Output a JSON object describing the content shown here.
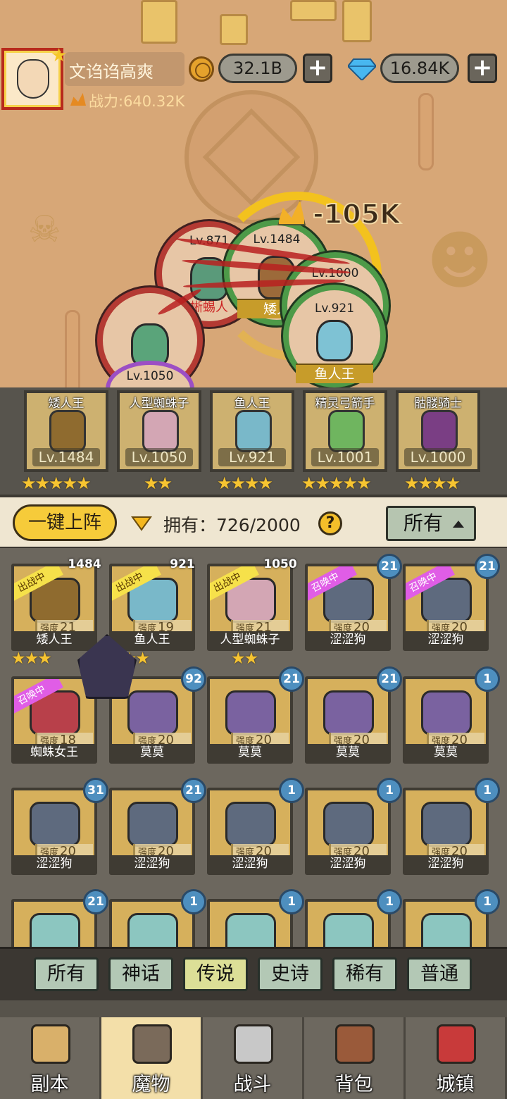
{
  "player": {
    "name": "文诌诌高爽",
    "power": "战力:640.32K",
    "gold": "32.1B",
    "gems": "16.84K"
  },
  "battle": {
    "damage": "-105K",
    "units": [
      {
        "level": "Lv.871",
        "label": "蜥蜴人"
      },
      {
        "level": "Lv.1484",
        "label": "矮人"
      },
      {
        "level": "Lv.1000",
        "label": ""
      },
      {
        "level": "Lv.921",
        "label": "鱼人王"
      },
      {
        "level": "Lv.1050",
        "label": ""
      },
      {
        "level": "",
        "label": ""
      }
    ]
  },
  "team": [
    {
      "name": "矮人王",
      "level": "Lv.1484",
      "stars": "★★★★★",
      "color": "#8f6b2f"
    },
    {
      "name": "人型蜘蛛子",
      "level": "Lv.1050",
      "stars": "★★",
      "color": "#d3a6b4"
    },
    {
      "name": "鱼人王",
      "level": "Lv.921",
      "stars": "★★★★",
      "color": "#79b8c9"
    },
    {
      "name": "精灵弓箭手",
      "level": "Lv.1001",
      "stars": "★★★★★",
      "color": "#6fb55f"
    },
    {
      "name": "骷髅骑士",
      "level": "Lv.1000",
      "stars": "★★★★",
      "color": "#7a3e84"
    }
  ],
  "toolbar": {
    "one_click": "一键上阵",
    "owned": "拥有：726/2000",
    "help": "?",
    "filter": "所有"
  },
  "monsters": [
    {
      "name": "矮人王",
      "strength_label": "强度",
      "strength": "21",
      "badge": "1484",
      "tag": "出战中",
      "tag_color": "yellow",
      "stars": "★★★"
    },
    {
      "name": "鱼人王",
      "strength_label": "强度",
      "strength": "19",
      "badge": "921",
      "tag": "出战中",
      "tag_color": "yellow",
      "stars": "★★★"
    },
    {
      "name": "人型蜘蛛子",
      "strength_label": "强度",
      "strength": "21",
      "badge": "1050",
      "tag": "出战中",
      "tag_color": "yellow",
      "stars": "★★"
    },
    {
      "name": "涩涩狗",
      "strength_label": "强度",
      "strength": "20",
      "badge": "21",
      "tag": "召唤中",
      "tag_color": "purple",
      "stars": ""
    },
    {
      "name": "涩涩狗",
      "strength_label": "强度",
      "strength": "20",
      "badge": "21",
      "tag": "召唤中",
      "tag_color": "purple",
      "stars": ""
    },
    {
      "name": "蜘蛛女王",
      "strength_label": "强度",
      "strength": "18",
      "badge": "",
      "tag": "召唤中",
      "tag_color": "purple",
      "stars": ""
    },
    {
      "name": "莫莫",
      "strength_label": "强度",
      "strength": "20",
      "badge": "92",
      "tag": "",
      "tag_color": "",
      "stars": ""
    },
    {
      "name": "莫莫",
      "strength_label": "强度",
      "strength": "20",
      "badge": "21",
      "tag": "",
      "tag_color": "",
      "stars": ""
    },
    {
      "name": "莫莫",
      "strength_label": "强度",
      "strength": "20",
      "badge": "21",
      "tag": "",
      "tag_color": "",
      "stars": ""
    },
    {
      "name": "莫莫",
      "strength_label": "强度",
      "strength": "20",
      "badge": "1",
      "tag": "",
      "tag_color": "",
      "stars": ""
    },
    {
      "name": "涩涩狗",
      "strength_label": "强度",
      "strength": "20",
      "badge": "31",
      "tag": "",
      "tag_color": "",
      "stars": ""
    },
    {
      "name": "涩涩狗",
      "strength_label": "强度",
      "strength": "20",
      "badge": "21",
      "tag": "",
      "tag_color": "",
      "stars": ""
    },
    {
      "name": "涩涩狗",
      "strength_label": "强度",
      "strength": "20",
      "badge": "1",
      "tag": "",
      "tag_color": "",
      "stars": ""
    },
    {
      "name": "涩涩狗",
      "strength_label": "强度",
      "strength": "20",
      "badge": "1",
      "tag": "",
      "tag_color": "",
      "stars": ""
    },
    {
      "name": "涩涩狗",
      "strength_label": "强度",
      "strength": "20",
      "badge": "1",
      "tag": "",
      "tag_color": "",
      "stars": ""
    },
    {
      "name": "",
      "strength_label": "",
      "strength": "",
      "badge": "21",
      "tag": "",
      "tag_color": "",
      "stars": ""
    },
    {
      "name": "",
      "strength_label": "",
      "strength": "",
      "badge": "1",
      "tag": "",
      "tag_color": "",
      "stars": ""
    },
    {
      "name": "",
      "strength_label": "",
      "strength": "",
      "badge": "1",
      "tag": "",
      "tag_color": "",
      "stars": ""
    },
    {
      "name": "",
      "strength_label": "",
      "strength": "",
      "badge": "1",
      "tag": "",
      "tag_color": "",
      "stars": ""
    },
    {
      "name": "",
      "strength_label": "",
      "strength": "",
      "badge": "1",
      "tag": "",
      "tag_color": "",
      "stars": ""
    }
  ],
  "rarity_tabs": [
    {
      "label": "所有",
      "active": false
    },
    {
      "label": "神话",
      "active": false
    },
    {
      "label": "传说",
      "active": true
    },
    {
      "label": "史诗",
      "active": false
    },
    {
      "label": "稀有",
      "active": false
    },
    {
      "label": "普通",
      "active": false
    }
  ],
  "nav": [
    {
      "label": "副本",
      "icon": "map-icon",
      "active": false
    },
    {
      "label": "魔物",
      "icon": "monster-helmet-icon",
      "active": true
    },
    {
      "label": "战斗",
      "icon": "crossed-swords-icon",
      "active": false
    },
    {
      "label": "背包",
      "icon": "backpack-icon",
      "active": false
    },
    {
      "label": "城镇",
      "icon": "town-shop-icon",
      "active": false
    }
  ],
  "colors": {
    "accent": "#f6cb3a",
    "tag_active": "#f6e14a",
    "tag_summon": "#e05de6",
    "level_badge": "#4e8fbf"
  }
}
